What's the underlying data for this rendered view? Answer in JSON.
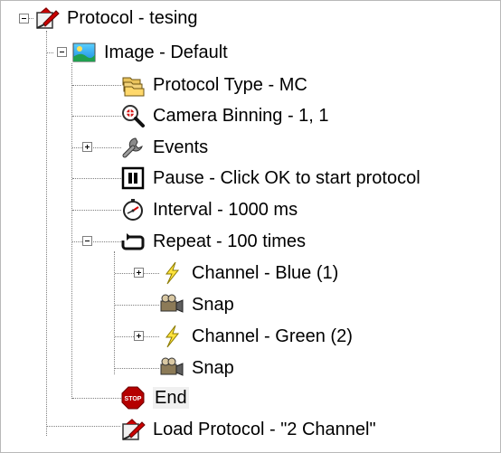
{
  "tree": {
    "protocol": {
      "label": "Protocol - tesing",
      "icon": "protocol-icon"
    },
    "image": {
      "label": "Image - Default",
      "icon": "image-icon"
    },
    "protocol_type": {
      "label": "Protocol Type - MC",
      "icon": "folders-icon"
    },
    "camera_binning": {
      "label": "Camera Binning - 1, 1",
      "icon": "magnifier-icon"
    },
    "events": {
      "label": "Events",
      "icon": "wrench-icon"
    },
    "pause": {
      "label": "Pause - Click OK to start protocol",
      "icon": "pause-icon"
    },
    "interval": {
      "label": "Interval - 1000 ms",
      "icon": "stopwatch-icon"
    },
    "repeat": {
      "label": "Repeat - 100 times",
      "icon": "repeat-icon"
    },
    "channel_blue": {
      "label": "Channel - Blue (1)",
      "icon": "lightning-icon"
    },
    "snap_1": {
      "label": "Snap",
      "icon": "camera-icon"
    },
    "channel_green": {
      "label": "Channel - Green (2)",
      "icon": "lightning-icon"
    },
    "snap_2": {
      "label": "Snap",
      "icon": "camera-icon"
    },
    "end": {
      "label": "End",
      "icon": "stop-sign-icon"
    },
    "load_protocol": {
      "label": "Load Protocol - \"2 Channel\"",
      "icon": "protocol-icon"
    }
  }
}
